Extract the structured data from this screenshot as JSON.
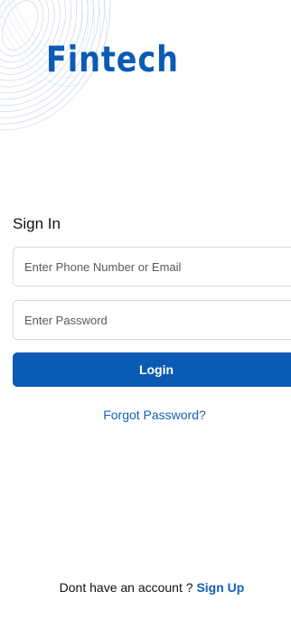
{
  "brand": {
    "name": "Fintech",
    "color": "#0b5bb4"
  },
  "signin": {
    "title": "Sign In",
    "phone_placeholder": "Enter Phone Number or Email",
    "password_placeholder": "Enter Password",
    "login_label": "Login",
    "forgot_label": "Forgot Password?"
  },
  "footer": {
    "prompt": "Dont have an account ?",
    "signup_label": "Sign Up"
  },
  "colors": {
    "accent": "#0b5bb4",
    "link": "#1660b8",
    "input_border": "#d9d9d9"
  }
}
